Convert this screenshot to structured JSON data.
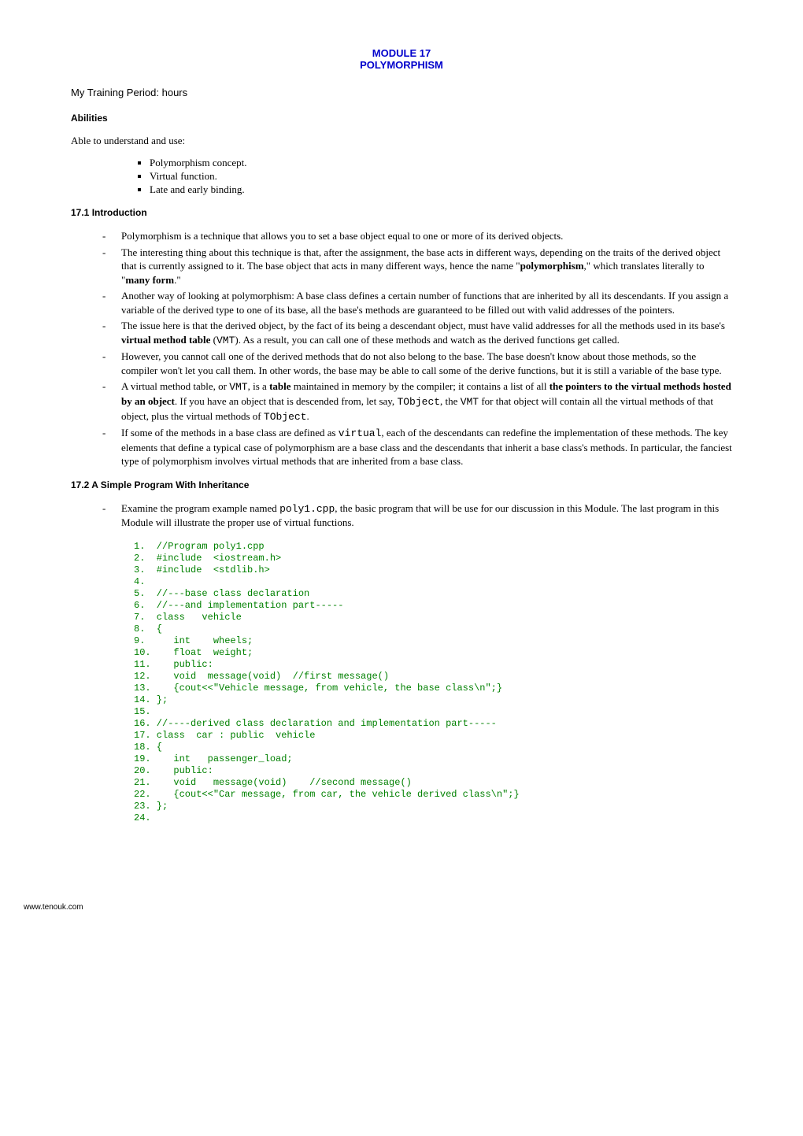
{
  "titles": {
    "module": "MODULE 17",
    "topic": "POLYMORPHISM"
  },
  "periodLabel": "My Training Period:        hours",
  "sections": {
    "abilities": {
      "header": "Abilities",
      "intro": "Able to understand and use:",
      "items": [
        "Polymorphism concept.",
        "Virtual function.",
        "Late and early binding."
      ]
    },
    "intro": {
      "header": "17.1    Introduction",
      "bullets": [
        "Polymorphism is a technique that allows you to set a base object equal to one or more of its derived objects.",
        "The interesting thing about this technique is that, after the assignment, the base acts in different ways, depending on the traits of the derived object that is currently assigned to it. The base object that acts in many different ways, hence the name \"<b>polymorphism</b>,\" which translates literally to \"<b>many form</b>.\"",
        "Another way of looking at polymorphism:  A base class defines a certain number of functions that are inherited by all its descendants.  If you assign a variable of the derived type to one of its base, all the base's methods are guaranteed to be filled out with valid addresses of the pointers.",
        "The issue here is that the derived object, by the fact of its being a descendant object, must have valid addresses for all the methods used in its base's <b>virtual method table</b> (<span class=\"mono\">VMT</span>).  As a result, you can call one of these methods and watch as the derived functions get called.",
        "However, you cannot call one of the derived methods that do not also belong to the base.  The base doesn't know about those methods, so the compiler won't let you call them.  In other words, the base may be able to call some of the derive functions, but it is still a variable of the base type.",
        "A virtual method table, or <span class=\"mono\">VMT</span>, is a <b>table</b> maintained in memory by the compiler; it contains a list of all <b>the pointers to the virtual methods hosted by an object</b>. If you have an object that is descended from, let say, <span class=\"mono\">TObject</span>, the <span class=\"mono\">VMT</span> for that object will contain all the virtual methods of that object, plus the virtual methods of <span class=\"mono\">TObject</span>.",
        "If some of the methods in a base class are defined as <span class=\"mono\">virtual</span>, each of the descendants can redefine the implementation of these methods. The key elements that define a typical case of polymorphism are a base class and the descendants that inherit a base class's methods. In particular, the fanciest type of polymorphism involves virtual methods that are inherited from a base class."
      ]
    },
    "simple": {
      "header": "17.2   A Simple Program With Inheritance",
      "bullets": [
        "Examine the program example named <span class=\"mono\">poly1.cpp</span>, the basic program that will be use for our discussion in this Module.  The last program in this Module will illustrate the proper use of virtual functions."
      ]
    }
  },
  "code": "1.  //Program poly1.cpp\n2.  #include  <iostream.h>\n3.  #include  <stdlib.h>\n4.  \n5.  //---base class declaration\n6.  //---and implementation part-----\n7.  class   vehicle\n8.  {\n9.     int    wheels;\n10.    float  weight;\n11.    public:\n12.    void  message(void)  //first message()\n13.    {cout<<\"Vehicle message, from vehicle, the base class\\n\";}\n14. };\n15. \n16. //----derived class declaration and implementation part-----\n17. class  car : public  vehicle\n18. {\n19.    int   passenger_load;\n20.    public:\n21.    void   message(void)    //second message()\n22.    {cout<<\"Car message, from car, the vehicle derived class\\n\";}\n23. };\n24. ",
  "footer": "www.tenouk.com"
}
